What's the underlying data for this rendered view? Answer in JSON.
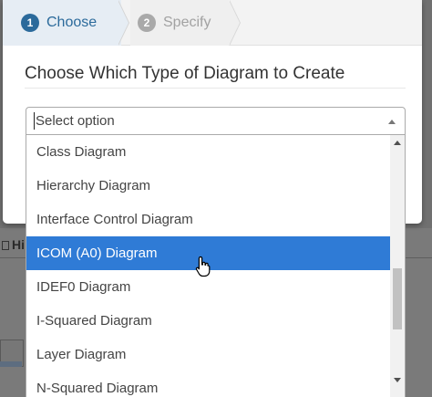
{
  "wizard": {
    "steps": [
      {
        "number": "1",
        "label": "Choose",
        "active": true
      },
      {
        "number": "2",
        "label": "Specify",
        "active": false
      }
    ]
  },
  "modal": {
    "title": "Choose Which Type of Diagram to Create"
  },
  "select": {
    "placeholder": "Select option",
    "options": [
      {
        "label": "Class Diagram",
        "highlighted": false
      },
      {
        "label": "Hierarchy Diagram",
        "highlighted": false
      },
      {
        "label": "Interface Control Diagram",
        "highlighted": false
      },
      {
        "label": "ICOM (A0) Diagram",
        "highlighted": true
      },
      {
        "label": "IDEF0 Diagram",
        "highlighted": false
      },
      {
        "label": "I-Squared Diagram",
        "highlighted": false
      },
      {
        "label": "Layer Diagram",
        "highlighted": false
      },
      {
        "label": "N-Squared Diagram",
        "highlighted": false
      }
    ]
  },
  "background": {
    "heading": "Hi"
  },
  "colors": {
    "accent": "#2b6a9b",
    "highlight": "#2f7bd6",
    "step_inactive": "#a2a2a2"
  },
  "icons": {
    "cursor": "hand-pointer-icon",
    "select_arrow": "caret-up-icon",
    "scroll_up": "scroll-up-arrow-icon",
    "scroll_down": "scroll-down-arrow-icon"
  }
}
